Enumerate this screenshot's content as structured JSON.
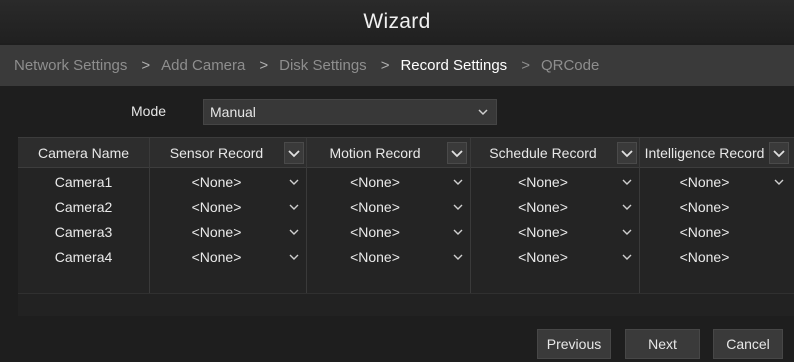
{
  "window": {
    "title": "Wizard"
  },
  "steps": [
    {
      "label": "Network Settings"
    },
    {
      "label": "Add Camera"
    },
    {
      "label": "Disk Settings"
    },
    {
      "label": "Record Settings"
    },
    {
      "label": "QRCode"
    }
  ],
  "step_separator": ">",
  "mode": {
    "label": "Mode",
    "value": "Manual"
  },
  "table": {
    "headers": [
      "Camera Name",
      "Sensor Record",
      "Motion Record",
      "Schedule Record",
      "Intelligence Record"
    ],
    "rows": [
      {
        "camera": "Camera1",
        "sensor": "<None>",
        "motion": "<None>",
        "schedule": "<None>",
        "intelligence": "<None>"
      },
      {
        "camera": "Camera2",
        "sensor": "<None>",
        "motion": "<None>",
        "schedule": "<None>",
        "intelligence": "<None>"
      },
      {
        "camera": "Camera3",
        "sensor": "<None>",
        "motion": "<None>",
        "schedule": "<None>",
        "intelligence": "<None>"
      },
      {
        "camera": "Camera4",
        "sensor": "<None>",
        "motion": "<None>",
        "schedule": "<None>",
        "intelligence": "<None>"
      }
    ]
  },
  "buttons": {
    "previous": "Previous",
    "next": "Next",
    "cancel": "Cancel"
  },
  "icons": {
    "dropdown": "chevron-down-icon"
  },
  "colors": {
    "background": "#1e1e1e",
    "step_bar": "#3a3a3a",
    "active_step": "#ffffff",
    "inactive_step": "#8e8e8e"
  }
}
